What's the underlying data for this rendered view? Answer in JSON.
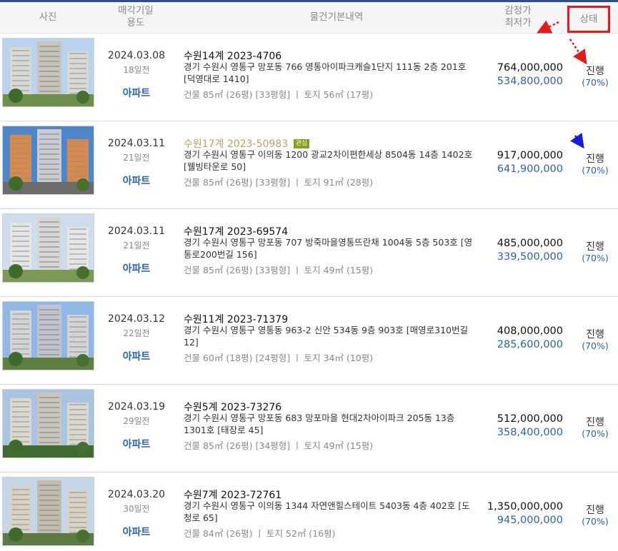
{
  "header": {
    "photo": "사진",
    "date_line1": "매각기일",
    "date_line2": "용도",
    "info": "물건기본내역",
    "price_line1": "감정가",
    "price_line2": "최저가",
    "status": "상태"
  },
  "rows": [
    {
      "date": "2024.03.08",
      "dday": "18일전",
      "usage": "아파트",
      "case": "수원14계 2023-4706",
      "highlighted": false,
      "badge": "",
      "address": "경기 수원시 영통구 망포동 766 영통아이파크캐슬1단지 111동 2층 201호 [덕영대로 1410]",
      "area": "건물 85㎡ (26평) [33평형]  ㅣ  토지 56㎡ (17평)",
      "appraisal": "764,000,000",
      "min_price": "534,800,000",
      "status": "진행",
      "ratio": "(70%)"
    },
    {
      "date": "2024.03.11",
      "dday": "21일전",
      "usage": "아파트",
      "case": "수원17계 2023-50983",
      "highlighted": true,
      "badge": "관심",
      "address": "경기 수원시 영통구 이의동 1200 광교2차이편한세상 8504동 14층 1402호 [웰빙타운로 50]",
      "area": "건물 85㎡ (26평) [33평형]  ㅣ  토지 91㎡ (28평)",
      "appraisal": "917,000,000",
      "min_price": "641,900,000",
      "status": "진행",
      "ratio": "(70%)"
    },
    {
      "date": "2024.03.11",
      "dday": "21일전",
      "usage": "아파트",
      "case": "수원17계 2023-69574",
      "highlighted": false,
      "badge": "",
      "address": "경기 수원시 영통구 망포동 707 방죽마을영통뜨란채 1004동 5층 503호 [영통로200번길 156]",
      "area": "건물 85㎡ (26평) [33평형]  ㅣ  토지 49㎡ (15평)",
      "appraisal": "485,000,000",
      "min_price": "339,500,000",
      "status": "진행",
      "ratio": "(70%)"
    },
    {
      "date": "2024.03.12",
      "dday": "22일전",
      "usage": "아파트",
      "case": "수원11계 2023-71379",
      "highlighted": false,
      "badge": "",
      "address": "경기 수원시 영통구 영통동 963-2 신안 534동 9층 903호 [매영로310번길 12]",
      "area": "건물 60㎡ (18평) [24평형]  ㅣ  토지 34㎡ (10평)",
      "appraisal": "408,000,000",
      "min_price": "285,600,000",
      "status": "진행",
      "ratio": "(70%)"
    },
    {
      "date": "2024.03.19",
      "dday": "29일전",
      "usage": "아파트",
      "case": "수원5계 2023-73276",
      "highlighted": false,
      "badge": "",
      "address": "경기 수원시 영통구 망포동 683 망포마을 현대2차아이파크 205동 13층 1301호 [태장로 45]",
      "area": "건물 85㎡ (26평) [34평형]  ㅣ  토지 49㎡ (15평)",
      "appraisal": "512,000,000",
      "min_price": "358,400,000",
      "status": "진행",
      "ratio": "(70%)"
    },
    {
      "date": "2024.03.20",
      "dday": "30일전",
      "usage": "아파트",
      "case": "수원7계 2023-72761",
      "highlighted": false,
      "badge": "",
      "address": "경기 수원시 영통구 이의동 1344 자연앤힐스테이트 5403동 4층 402호 [도청로 65]",
      "area": "건물 84㎡ (26평)  ㅣ  토지 52㎡ (16평)",
      "appraisal": "1,350,000,000",
      "min_price": "945,000,000",
      "status": "진행",
      "ratio": "(70%)"
    }
  ],
  "colors": {
    "accent_red": "#e31b1b",
    "link_blue": "#2b62b0",
    "highlight_gold": "#b7a169",
    "badge_green": "#8a9e1e"
  }
}
